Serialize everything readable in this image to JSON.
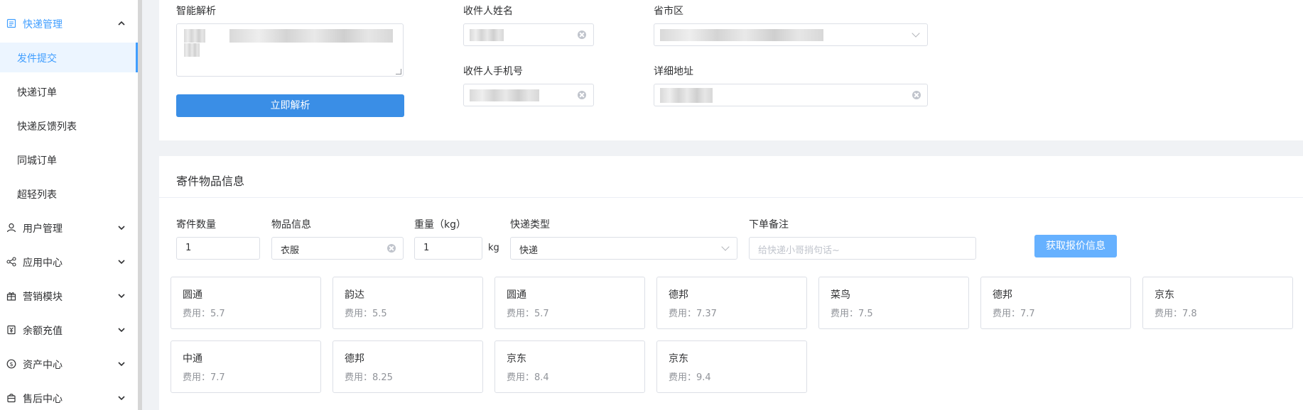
{
  "sidebar": {
    "groups": [
      {
        "label": "快递管理",
        "icon": "list-icon",
        "expanded": true
      },
      {
        "label": "用户管理",
        "icon": "user-icon"
      },
      {
        "label": "应用中心",
        "icon": "share-icon"
      },
      {
        "label": "营销模块",
        "icon": "gift-icon"
      },
      {
        "label": "余额充值",
        "icon": "recharge-icon"
      },
      {
        "label": "资产中心",
        "icon": "dollar-icon"
      },
      {
        "label": "售后中心",
        "icon": "bag-icon"
      }
    ],
    "sub_items": [
      "发件提交",
      "快递订单",
      "快递反馈列表",
      "同城订单",
      "超轻列表"
    ],
    "selected_sub": "发件提交"
  },
  "address": {
    "smart_parse_label": "智能解析",
    "parse_button": "立即解析",
    "receiver_name_label": "收件人姓名",
    "receiver_phone_label": "收件人手机号",
    "region_label": "省市区",
    "detail_address_label": "详细地址"
  },
  "goods": {
    "section_title": "寄件物品信息",
    "quantity_label": "寄件数量",
    "quantity_value": "1",
    "item_label": "物品信息",
    "item_value": "衣服",
    "weight_label": "重量（kg）",
    "weight_value": "1",
    "weight_unit": "kg",
    "type_label": "快递类型",
    "type_value": "快递",
    "remark_label": "下单备注",
    "remark_placeholder": "给快递小哥捎句话~",
    "quote_button": "获取报价信息"
  },
  "quotes": [
    {
      "carrier": "圆通",
      "fee": "费用：5.7"
    },
    {
      "carrier": "韵达",
      "fee": "费用：5.5"
    },
    {
      "carrier": "圆通",
      "fee": "费用：5.7"
    },
    {
      "carrier": "德邦",
      "fee": "费用：7.37"
    },
    {
      "carrier": "菜鸟",
      "fee": "费用：7.5"
    },
    {
      "carrier": "德邦",
      "fee": "费用：7.7"
    },
    {
      "carrier": "京东",
      "fee": "费用：7.8"
    },
    {
      "carrier": "中通",
      "fee": "费用：7.7"
    },
    {
      "carrier": "德邦",
      "fee": "费用：8.25"
    },
    {
      "carrier": "京东",
      "fee": "费用：8.4"
    },
    {
      "carrier": "京东",
      "fee": "费用：9.4"
    }
  ],
  "colors": {
    "accent": "#409eff",
    "quote_button": "#66b1ff",
    "parse_button": "#3a8ee6"
  }
}
